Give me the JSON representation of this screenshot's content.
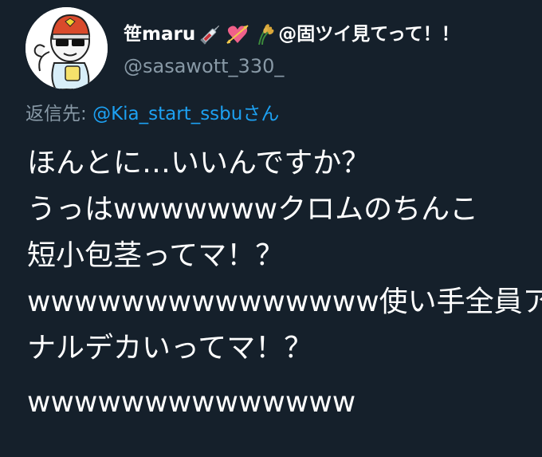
{
  "user": {
    "display_name": "笹maru",
    "emojis": [
      "syringe-emoji",
      "heart-with-arrow-emoji",
      "rice-plant-emoji"
    ],
    "name_suffix": "@固ツイ見てって！！",
    "handle": "@sasawott_330_"
  },
  "reply": {
    "label": "返信先: ",
    "user": "@Kia_start_ssbuさん"
  },
  "tweet": {
    "lines": [
      "ほんとに…いいんですか？",
      "うっはwwwwwwwクロムのちんこ",
      "短小包茎ってマ！？",
      "wwwwwwwwwwwwwww使い手全員ア",
      "ナルデカいってマ！？",
      "wwwwwwwwwwwwww"
    ]
  },
  "colors": {
    "background": "#15202b",
    "text": "#ffffff",
    "secondary": "#8899a6",
    "link": "#1da1f2"
  }
}
